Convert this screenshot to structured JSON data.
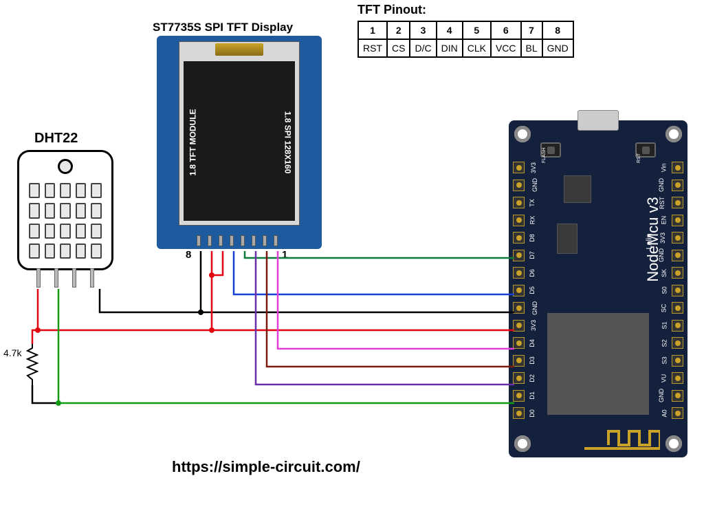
{
  "title_dht": "DHT22",
  "title_tft": "ST7735S SPI TFT Display",
  "title_pinout": "TFT Pinout:",
  "pinout_nums": [
    "1",
    "2",
    "3",
    "4",
    "5",
    "6",
    "7",
    "8"
  ],
  "pinout_names": [
    "RST",
    "CS",
    "D/C",
    "DIN",
    "CLK",
    "VCC",
    "BL",
    "GND"
  ],
  "tft_left": "1.8 TFT MODULE",
  "tft_right": "1.8 SPI 128X160",
  "tft_pin_first": "1",
  "tft_pin_last": "8",
  "mcu_title": "NodeMcu v3",
  "mcu_sub": "Lolin",
  "mcu_btn_flash": "FLASH",
  "mcu_btn_rst": "RST",
  "mcu_pins_left": [
    "3V3",
    "GND",
    "TX",
    "RX",
    "D8",
    "D7",
    "D6",
    "D5",
    "GND",
    "3V3",
    "D4",
    "D3",
    "D2",
    "D1",
    "D0"
  ],
  "mcu_pins_right": [
    "Vin",
    "GND",
    "RST",
    "EN",
    "3V3",
    "GND",
    "SK",
    "S0",
    "SC",
    "S1",
    "S2",
    "S3",
    "VU",
    "GND",
    "A0"
  ],
  "resistor_value": "4.7k",
  "url": "https://simple-circuit.com/",
  "colors": {
    "red": "#e20613",
    "black": "#000000",
    "green": "#129b12",
    "blue": "#1840d6",
    "magenta": "#e23bd7",
    "darkred": "#7b1a0e",
    "orange": "#d98b18",
    "purple": "#6a2ea8",
    "darkgreen": "#0c7a3a"
  },
  "wiring": [
    {
      "from": "DHT22 VCC",
      "to": "NodeMCU 3V3",
      "via": "red",
      "notes": "through 4.7k pull-up to DATA"
    },
    {
      "from": "DHT22 DATA",
      "to": "NodeMCU D1",
      "via": "green"
    },
    {
      "from": "DHT22 GND",
      "to": "NodeMCU GND",
      "via": "black"
    },
    {
      "from": "TFT RST (1)",
      "to": "NodeMCU D4",
      "via": "magenta"
    },
    {
      "from": "TFT CS (2)",
      "to": "NodeMCU D3",
      "via": "darkred/orange"
    },
    {
      "from": "TFT D/C (3)",
      "to": "NodeMCU D2",
      "via": "purple"
    },
    {
      "from": "TFT DIN (4)",
      "to": "NodeMCU D7",
      "via": "darkgreen"
    },
    {
      "from": "TFT CLK (5)",
      "to": "NodeMCU D5",
      "via": "blue"
    },
    {
      "from": "TFT VCC (6)",
      "to": "NodeMCU 3V3",
      "via": "red"
    },
    {
      "from": "TFT BL (7)",
      "to": "NodeMCU 3V3",
      "via": "red"
    },
    {
      "from": "TFT GND (8)",
      "to": "NodeMCU GND",
      "via": "black"
    }
  ]
}
